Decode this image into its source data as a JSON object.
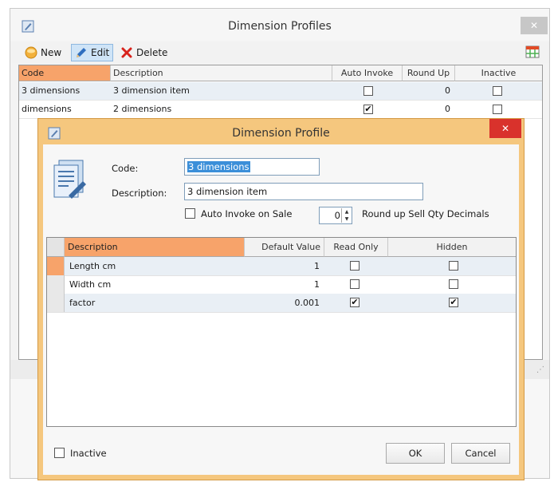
{
  "outer_window": {
    "title": "Dimension Profiles",
    "close_glyph": "✕",
    "toolbar": {
      "new_label": "New",
      "edit_label": "Edit",
      "delete_label": "Delete"
    },
    "grid": {
      "columns": [
        "Code",
        "Description",
        "Auto Invoke",
        "Round Up",
        "Inactive"
      ],
      "rows": [
        {
          "code": "3 dimensions",
          "description": "3 dimension item",
          "auto_invoke": false,
          "round_up": "0",
          "inactive": false
        },
        {
          "code": "dimensions",
          "description": "2 dimensions",
          "auto_invoke": true,
          "round_up": "0",
          "inactive": false
        }
      ]
    }
  },
  "dialog": {
    "title": "Dimension Profile",
    "close_glyph": "✕",
    "code_label": "Code:",
    "code_value": "3 dimensions",
    "description_label": "Description:",
    "description_value": "3 dimension item",
    "auto_invoke_label": "Auto Invoke on Sale",
    "auto_invoke_checked": false,
    "round_up_value": "0",
    "round_up_label": "Round up Sell Qty Decimals",
    "grid": {
      "columns": [
        "Description",
        "Default Value",
        "Read Only",
        "Hidden"
      ],
      "rows": [
        {
          "description": "Length cm",
          "default_value": "1",
          "read_only": false,
          "hidden": false
        },
        {
          "description": "Width cm",
          "default_value": "1",
          "read_only": false,
          "hidden": false
        },
        {
          "description": "factor",
          "default_value": "0.001",
          "read_only": true,
          "hidden": true
        }
      ]
    },
    "inactive_label": "Inactive",
    "inactive_checked": false,
    "ok_label": "OK",
    "cancel_label": "Cancel"
  },
  "colors": {
    "selected_header": "#f7a36a",
    "dialog_frame": "#f5c77e",
    "dialog_close": "#d9322c",
    "text_selection": "#3b8fd9"
  },
  "icons": {
    "app": "app-edit-icon",
    "new": "new-record-icon",
    "edit": "pencil-icon",
    "delete": "red-x-icon",
    "grid_layout": "grid-layout-icon",
    "profile": "document-profile-icon"
  }
}
